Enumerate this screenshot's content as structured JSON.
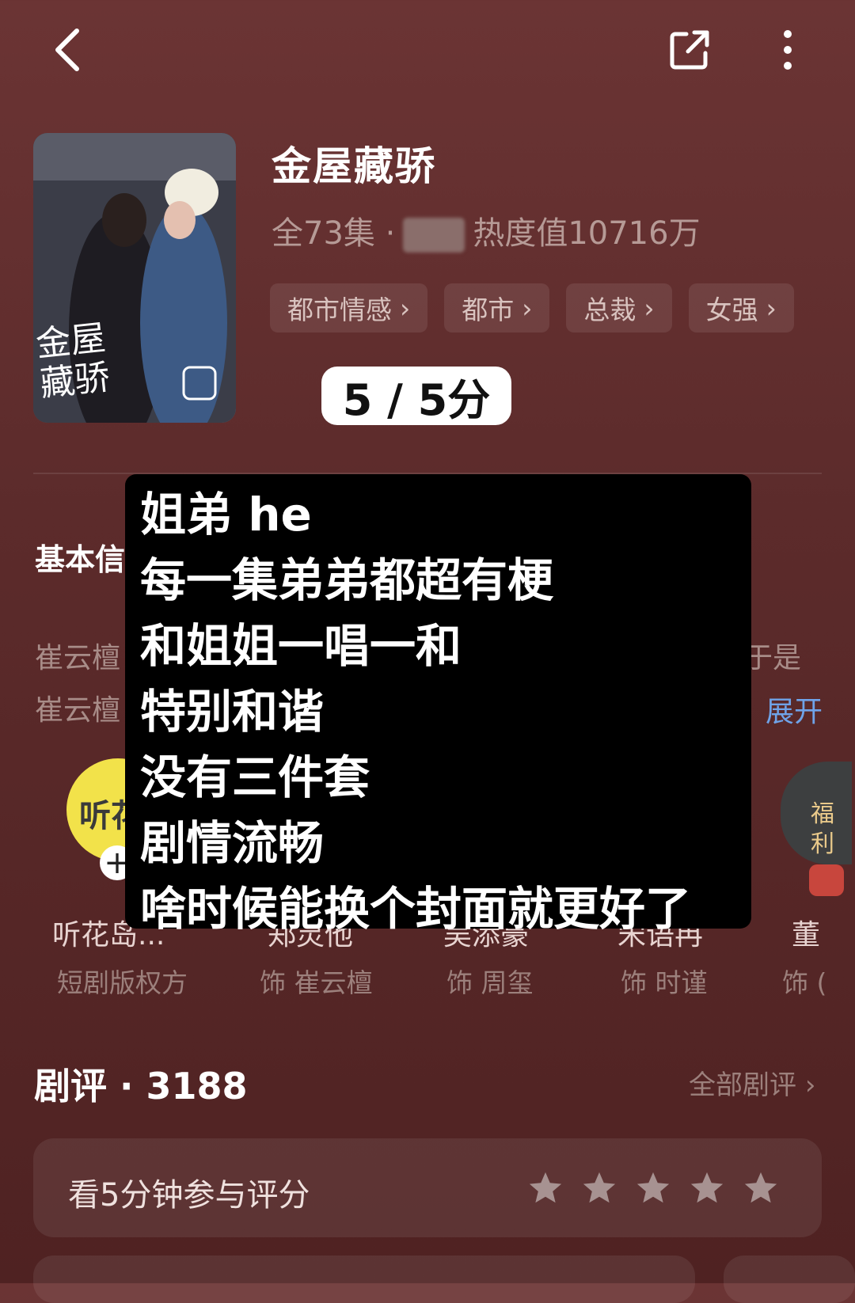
{
  "topbar": {
    "back_icon": "chevron-left-icon",
    "share_icon": "share-icon",
    "more_icon": "more-vertical-icon"
  },
  "drama": {
    "title": "金屋藏骄",
    "episodes": "全73集 ·",
    "heat": "热度值10716万",
    "tags": [
      "都市情感",
      "都市",
      "总裁",
      "女强"
    ],
    "poster_title": "金屋藏骄"
  },
  "overlay": {
    "rating": "5 / 5分",
    "lines": [
      "姐弟 he",
      "每一集弟弟都超有梗",
      "和姐姐一唱一和",
      "特别和谐",
      "没有三件套",
      "剧情流畅",
      "啥时候能换个封面就更好了"
    ]
  },
  "basic_info": {
    "title": "基本信",
    "line1_left": "崔云檀",
    "line1_right": "于是",
    "line2_left": "崔云檀",
    "expand_label": "展开"
  },
  "cast": [
    {
      "name": "听花岛...",
      "role": "短剧版权方",
      "avatar_text": "听花"
    },
    {
      "name": "郑灵他",
      "role": "饰 崔云檀"
    },
    {
      "name": "吴添豪",
      "role": "饰 周玺"
    },
    {
      "name": "宋语冉",
      "role": "饰 时谨"
    },
    {
      "name": "董",
      "role": "饰 (",
      "badge": "福利"
    }
  ],
  "reviews": {
    "title": "剧评 · 3188",
    "all_label": "全部剧评",
    "rate_prompt": "看5分钟参与评分",
    "star_count": 5
  },
  "colors": {
    "background": "#5c2b2b",
    "accent_link": "#6fa3e8",
    "overlay_bg": "#000000"
  }
}
